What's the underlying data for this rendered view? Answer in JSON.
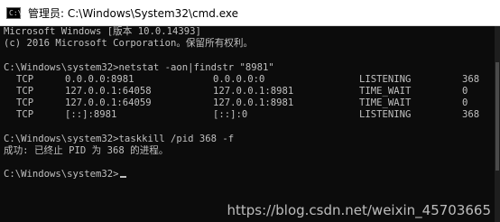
{
  "window": {
    "title": "管理员: C:\\Windows\\System32\\cmd.exe",
    "icon": "cmd-icon"
  },
  "console": {
    "lines": [
      "Microsoft Windows [版本 10.0.14393]",
      "(c) 2016 Microsoft Corporation。保留所有权利。",
      "",
      "C:\\Windows\\system32>netstat -aon|findstr \"8981\""
    ],
    "netstat_rows": [
      {
        "proto": "TCP",
        "local": "0.0.0.0:8981",
        "foreign": "0.0.0.0:0",
        "state": "LISTENING",
        "pid": "368"
      },
      {
        "proto": "TCP",
        "local": "127.0.0.1:64058",
        "foreign": "127.0.0.1:8981",
        "state": "TIME_WAIT",
        "pid": "0"
      },
      {
        "proto": "TCP",
        "local": "127.0.0.1:64059",
        "foreign": "127.0.0.1:8981",
        "state": "TIME_WAIT",
        "pid": "0"
      },
      {
        "proto": "TCP",
        "local": "[::]:8981",
        "foreign": "[::]:0",
        "state": "LISTENING",
        "pid": "368"
      }
    ],
    "after_lines": [
      "",
      "C:\\Windows\\system32>taskkill /pid 368 -f",
      "成功: 已终止 PID 为 368 的进程。",
      ""
    ],
    "prompt": "C:\\Windows\\system32>"
  },
  "watermark": "https://blog.csdn.net/weixin_45703665",
  "colors": {
    "background": "#0c0c0c",
    "text": "#c0c0c0",
    "titlebar": "#ffffff"
  }
}
